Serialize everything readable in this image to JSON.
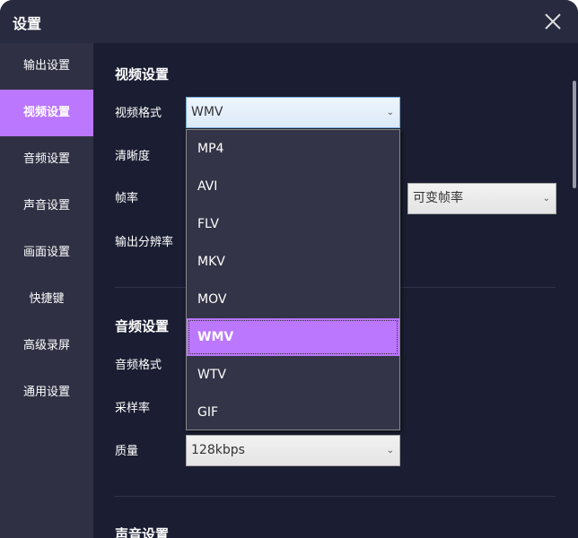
{
  "window": {
    "title": "设置"
  },
  "sidebar": {
    "items": [
      {
        "label": "输出设置"
      },
      {
        "label": "视频设置"
      },
      {
        "label": "音频设置"
      },
      {
        "label": "声音设置"
      },
      {
        "label": "画面设置"
      },
      {
        "label": "快捷键"
      },
      {
        "label": "高级录屏"
      },
      {
        "label": "通用设置"
      }
    ],
    "active_index": 1
  },
  "video": {
    "heading": "视频设置",
    "format_label": "视频格式",
    "format_value": "WMV",
    "clarity_label": "清晰度",
    "framerate_label": "帧率",
    "framerate_value": "可变帧率",
    "resolution_label": "输出分辨率"
  },
  "dropdown": {
    "options": [
      "MP4",
      "AVI",
      "FLV",
      "MKV",
      "MOV",
      "WMV",
      "WTV",
      "GIF"
    ],
    "selected": "WMV"
  },
  "audio": {
    "heading": "音频设置",
    "format_label": "音频格式",
    "samplerate_label": "采样率",
    "quality_label": "质量",
    "quality_value": "128kbps"
  },
  "sound": {
    "heading": "声音设置"
  },
  "colors": {
    "accent": "#bb77fd",
    "background": "#1b1e32",
    "sidebar": "#2f3044",
    "titlebar": "#282a3f"
  }
}
